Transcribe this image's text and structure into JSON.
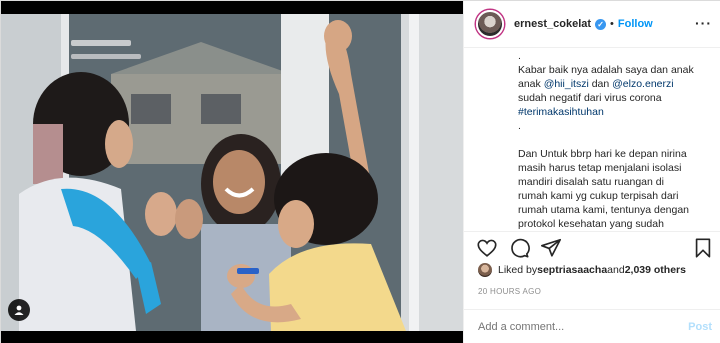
{
  "header": {
    "username": "ernest_cokelat",
    "verified_mark": "✓",
    "separator": "•",
    "follow_label": "Follow",
    "more_label": "···"
  },
  "caption": {
    "lines": [
      ".",
      "Kabar baik nya adalah saya dan anak",
      "anak ",
      "sudah negatif dari virus corona",
      "#terimakasihtuhan",
      ".",
      "Dan Untuk bbrp hari ke depan nirina",
      "masih harus tetap menjalani isolasi",
      "mandiri disalah satu ruangan di",
      "rumah kami yg cukup terpisah dari",
      "rumah utama kami, tentunya dengan",
      "protokol kesehatan yang sudah"
    ],
    "mention_1": "@hii_itszi",
    "mention_join": " dan ",
    "mention_2": "@elzo.enerzi"
  },
  "icons": {
    "like": "heart-icon",
    "comment": "comment-icon",
    "share": "share-icon",
    "save": "bookmark-icon",
    "tag": "user-tag-icon"
  },
  "likes": {
    "prefix": "Liked by ",
    "user": "septriasaacha",
    "middle": " and ",
    "count": "2,039 others"
  },
  "timestamp": "20 HOURS AGO",
  "comment": {
    "placeholder": "Add a comment...",
    "post_label": "Post"
  },
  "colors": {
    "link": "#00376b",
    "follow": "#0095f6",
    "post_disabled": "#b2dffc",
    "muted": "#8e8e8e"
  }
}
